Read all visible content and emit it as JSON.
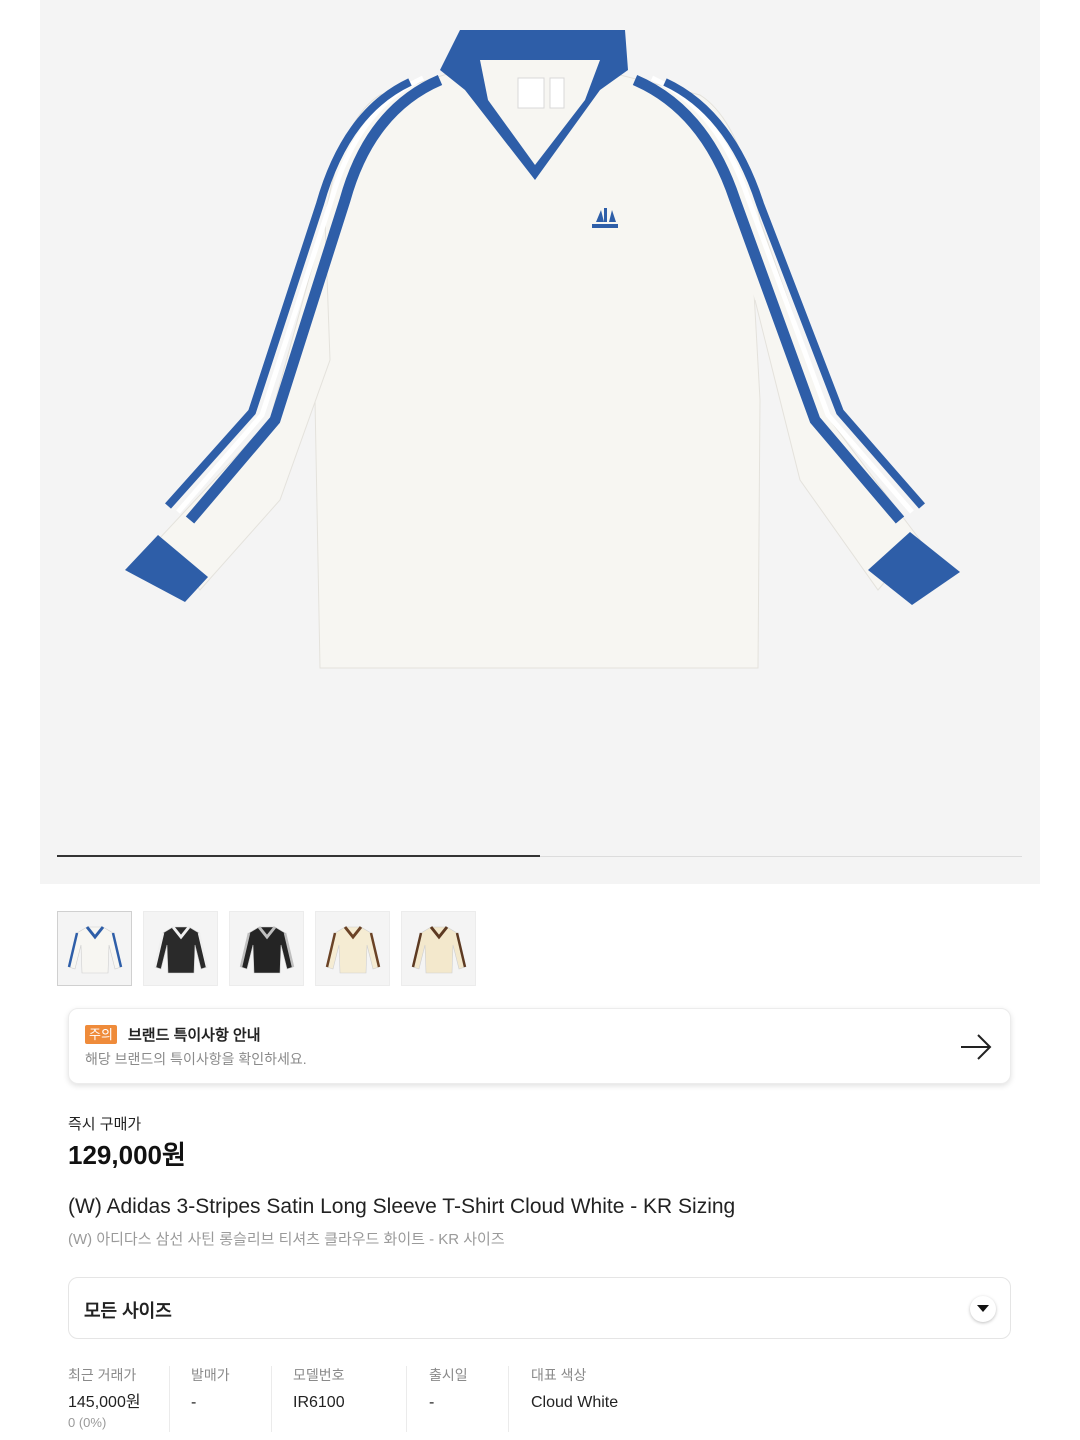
{
  "gallery": {
    "current_index": 1,
    "total_images": 2,
    "progress_fraction": 0.5,
    "thumbnail_count": 5,
    "thumbnails": [
      {
        "name": "cloud-white-blue",
        "body": "#f7f6f2",
        "trim": "#2e5ea8"
      },
      {
        "name": "black-white",
        "body": "#2a2a2a",
        "trim": "#f0f0f0"
      },
      {
        "name": "black-grey",
        "body": "#242424",
        "trim": "#bfbfbf"
      },
      {
        "name": "cream-brown",
        "body": "#f5ecd3",
        "trim": "#6b4326"
      },
      {
        "name": "cream-brown-2",
        "body": "#f3e8cc",
        "trim": "#5d3a22"
      }
    ]
  },
  "notice": {
    "badge": "주의",
    "title": "브랜드 특이사항 안내",
    "subtitle": "해당 브랜드의 특이사항을 확인하세요.",
    "icon": "arrow-right-icon",
    "badge_color": "#ef8b3a"
  },
  "price": {
    "label": "즉시 구매가",
    "value": "129,000원"
  },
  "product": {
    "name_en": "(W) Adidas 3-Stripes Satin Long Sleeve T-Shirt Cloud White - KR Sizing",
    "name_ko": "(W) 아디다스 삼선 사틴 롱슬리브 티셔츠 클라우드 화이트 - KR 사이즈",
    "body_color": "#f7f6f2",
    "trim_color": "#2e5ea8"
  },
  "size": {
    "selected": "모든 사이즈",
    "icon": "chevron-down-icon"
  },
  "info": [
    {
      "label": "최근 거래가",
      "value": "145,000원",
      "sub": "0 (0%)"
    },
    {
      "label": "발매가",
      "value": "-"
    },
    {
      "label": "모델번호",
      "value": "IR6100"
    },
    {
      "label": "출시일",
      "value": "-"
    },
    {
      "label": "대표 색상",
      "value": "Cloud White"
    }
  ]
}
